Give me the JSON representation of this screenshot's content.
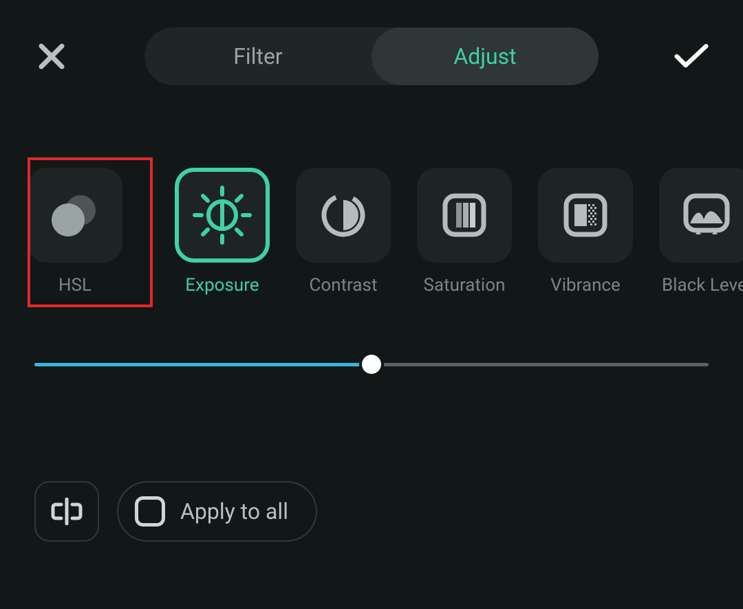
{
  "tabs": {
    "filter": "Filter",
    "adjust": "Adjust",
    "active": "adjust"
  },
  "tools": [
    {
      "id": "hsl",
      "label": "HSL",
      "highlighted": true
    },
    {
      "id": "exposure",
      "label": "Exposure",
      "selected": true
    },
    {
      "id": "contrast",
      "label": "Contrast"
    },
    {
      "id": "saturation",
      "label": "Saturation"
    },
    {
      "id": "vibrance",
      "label": "Vibrance"
    },
    {
      "id": "blacklevel",
      "label": "Black Level"
    }
  ],
  "slider": {
    "value": 50,
    "min": 0,
    "max": 100
  },
  "apply_all_label": "Apply to all",
  "colors": {
    "accent": "#3fd1a3",
    "slider_fill": "#33b8e5",
    "highlight": "#e22828"
  }
}
